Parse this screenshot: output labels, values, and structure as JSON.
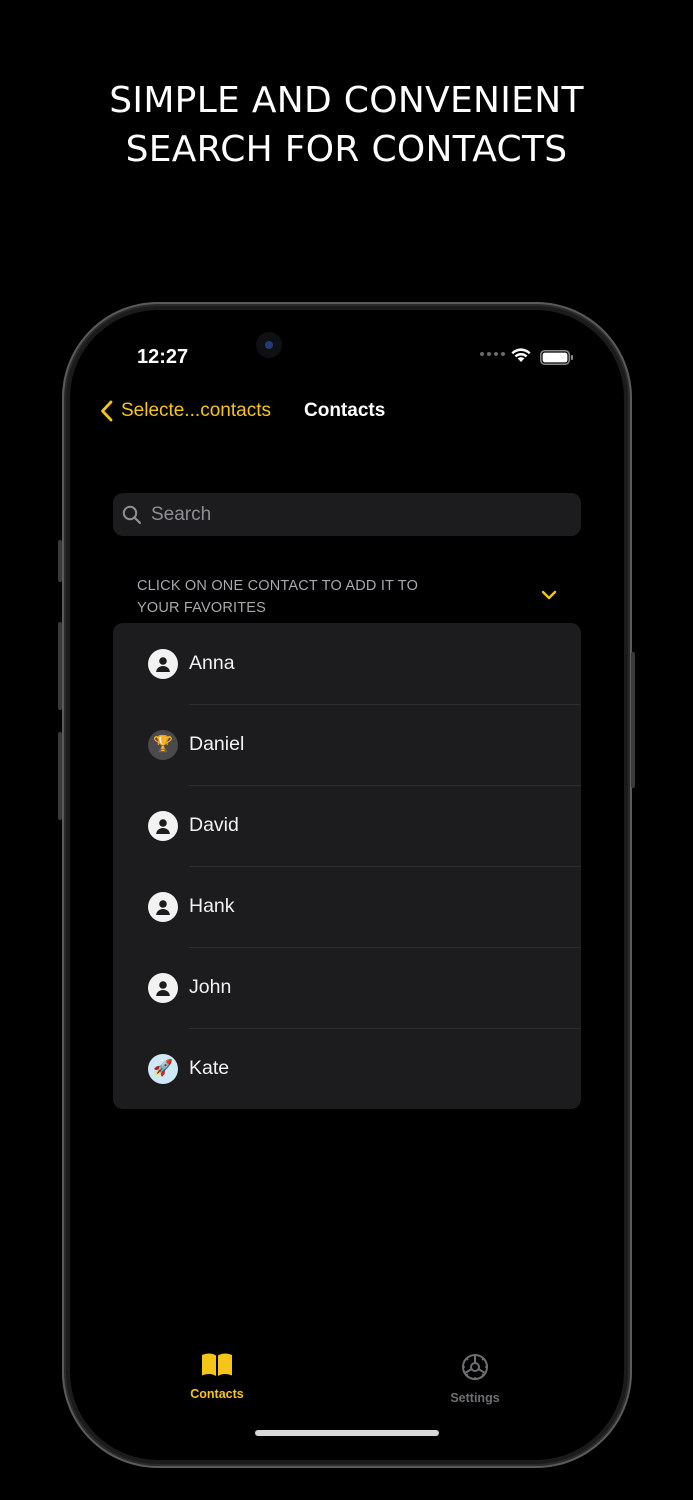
{
  "headline": {
    "line1": "SIMPLE AND CONVENIENT",
    "line2": "SEARCH FOR CONTACTS"
  },
  "status_bar": {
    "time": "12:27"
  },
  "nav": {
    "back_label": "Selecte...contacts",
    "title": "Contacts"
  },
  "search": {
    "placeholder": "Search"
  },
  "section": {
    "header": "CLICK ON ONE CONTACT TO ADD IT TO YOUR FAVORITES"
  },
  "contacts": [
    {
      "name": "Anna",
      "avatar": "person-icon"
    },
    {
      "name": "Daniel",
      "avatar": "trophy-emoji",
      "emoji": "🏆"
    },
    {
      "name": "David",
      "avatar": "person-icon"
    },
    {
      "name": "Hank",
      "avatar": "person-icon"
    },
    {
      "name": "John",
      "avatar": "person-icon"
    },
    {
      "name": "Kate",
      "avatar": "rocket-emoji",
      "emoji": "🚀"
    }
  ],
  "tabs": [
    {
      "label": "Contacts",
      "icon": "book-icon",
      "active": true
    },
    {
      "label": "Settings",
      "icon": "gear-icon",
      "active": false
    }
  ],
  "colors": {
    "accent": "#f5c518",
    "background": "#000000",
    "cell_background": "#1c1c1e",
    "secondary_text": "#a8a8ad"
  }
}
